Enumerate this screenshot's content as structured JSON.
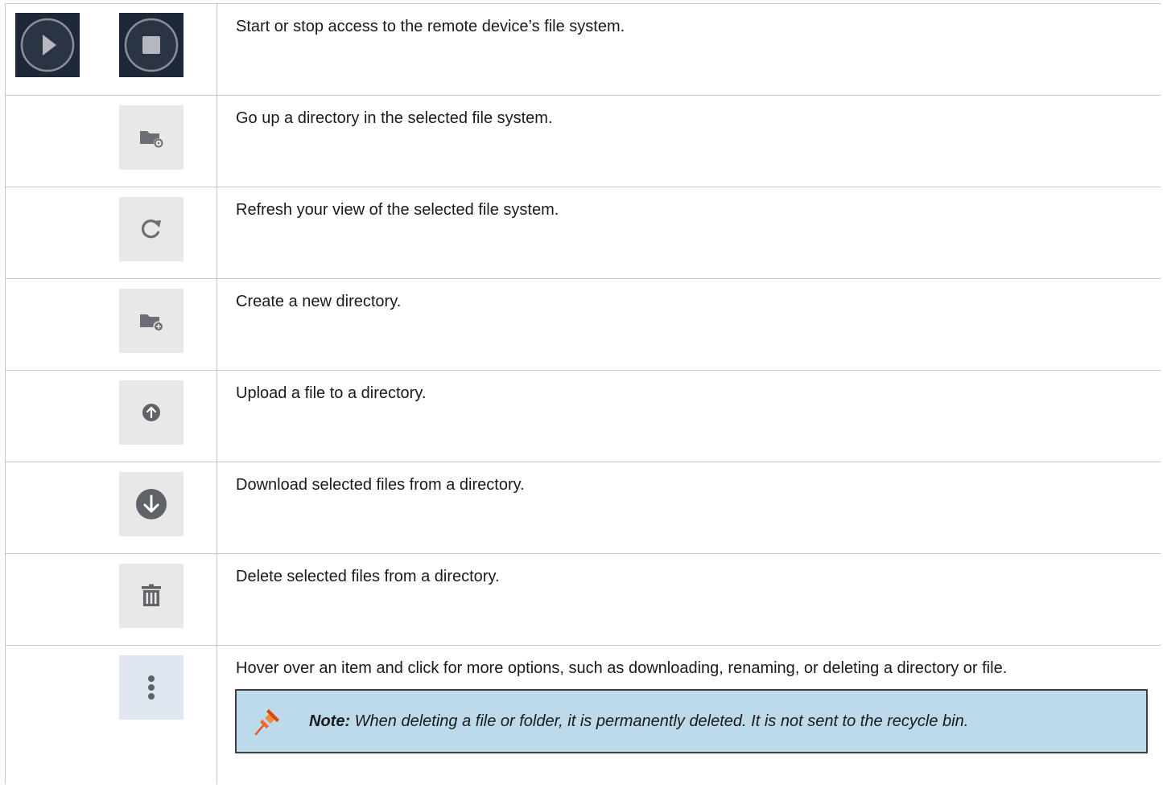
{
  "rows": [
    {
      "icons": [
        "play-circle-icon",
        "stop-circle-icon"
      ],
      "description": "Start or stop access to the remote device’s file system."
    },
    {
      "icons": [
        "folder-up-icon"
      ],
      "description": "Go up a directory in the selected file system."
    },
    {
      "icons": [
        "refresh-icon"
      ],
      "description": "Refresh your view of the selected file system."
    },
    {
      "icons": [
        "folder-add-icon"
      ],
      "description": "Create a new directory."
    },
    {
      "icons": [
        "upload-icon"
      ],
      "description": "Upload a file to a directory."
    },
    {
      "icons": [
        "download-icon"
      ],
      "description": "Download selected files from a directory."
    },
    {
      "icons": [
        "trash-icon"
      ],
      "description": "Delete selected files from a directory."
    },
    {
      "icons": [
        "more-options-icon"
      ],
      "description": "Hover over an item and click for more options, such as downloading, renaming, or deleting a directory or file."
    }
  ],
  "note": {
    "label": "Note:",
    "text": " When deleting a file or folder, it is permanently deleted. It is not sent to the recycle bin.",
    "icon": "pushpin-icon"
  },
  "colors": {
    "dark_button_bg": "#1f2836",
    "light_button_bg": "#e8e8e8",
    "icon_gray": "#5f6368",
    "note_bg": "#bddaeb",
    "pin_orange": "#f26522"
  }
}
